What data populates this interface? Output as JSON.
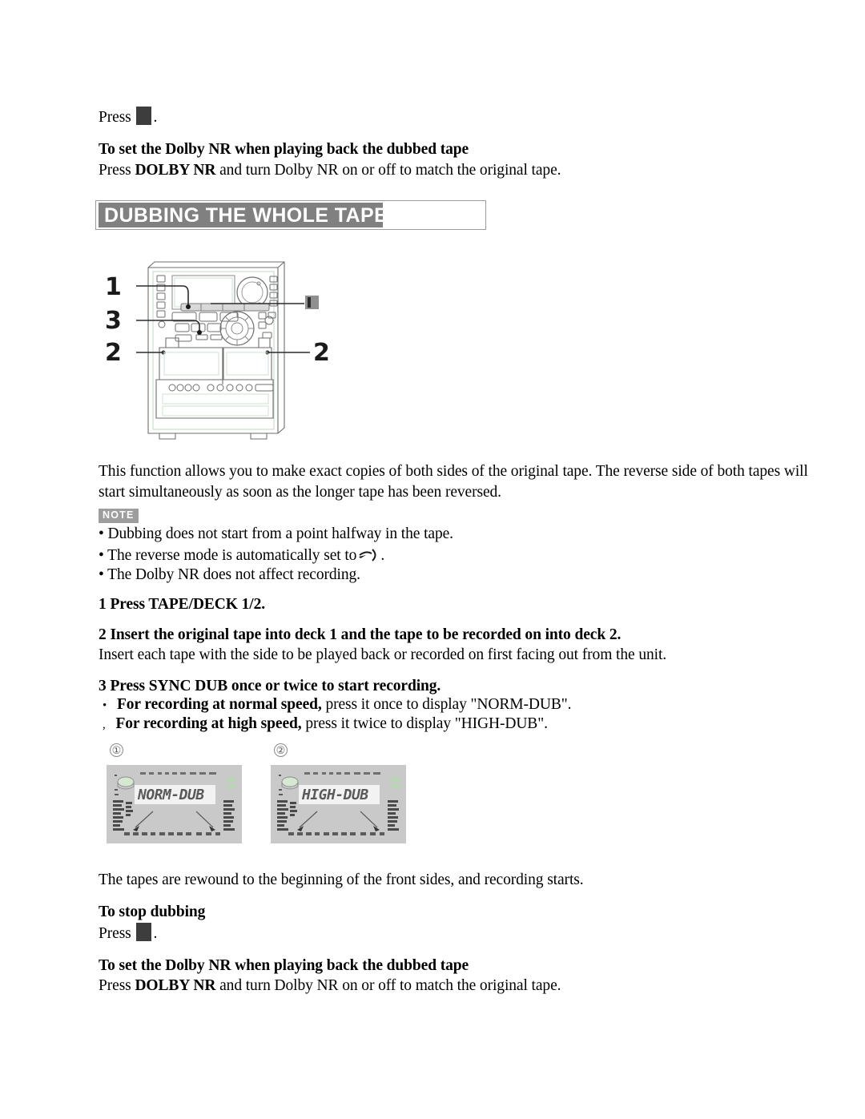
{
  "document": {
    "type": "audio-system-user-manual-page",
    "section_title": "DUBBING THE WHOLE TAPE"
  },
  "top_block": {
    "press_label": "Press",
    "press_icon": "stop-button-icon",
    "period": ".",
    "dolby_heading": "To set the Dolby NR when playing back the dubbed tape",
    "dolby_press": "Press",
    "dolby_button": "DOLBY NR",
    "dolby_rest": "and turn Dolby NR on or off to match the original tape."
  },
  "diagram": {
    "name": "stereo-system-front-panel-diagram",
    "callouts_left": [
      "1",
      "3",
      "2"
    ],
    "callouts_right": [
      "2"
    ],
    "right_icon": "stop-button-icon"
  },
  "intro": {
    "line1": "This function allows you to make exact copies of both sides of the original tape. The reverse side of both tapes will",
    "line2": "start simultaneously as soon as the longer tape has been reversed."
  },
  "note": {
    "badge": "NOTE",
    "bullets": [
      {
        "text": "Dubbing does not start from a point halfway in the tape.",
        "glyph": null
      },
      {
        "text": "The reverse mode is automatically set to",
        "glyph": "reverse-mode-loop-icon",
        "suffix": "."
      },
      {
        "text": "The Dolby NR does not affect recording.",
        "glyph": null
      }
    ]
  },
  "steps": [
    {
      "number": "1",
      "heading": "Press TAPE/DECK 1/2.",
      "body": null
    },
    {
      "number": "2",
      "heading": "Insert the original tape into deck 1 and the tape to be recorded on into deck 2.",
      "body": "Insert each tape with the side to be played back or recorded on first facing out from the unit."
    },
    {
      "number": "3",
      "heading": "Press SYNC DUB once or twice to start recording.",
      "body": null
    }
  ],
  "step3_bullets": [
    {
      "marker": "•",
      "bold": "For recording at normal speed,",
      "rest": "press it once to display \"NORM-DUB\"."
    },
    {
      "marker": ",",
      "bold": "For recording at high speed,",
      "rest": "press it twice to display \"HIGH-DUB\"."
    }
  ],
  "lcd_figures": [
    {
      "marker": "①",
      "display_text": "NORM-DUB",
      "name": "lcd-display-norm-dub"
    },
    {
      "marker": "②",
      "display_text": "HIGH-DUB",
      "name": "lcd-display-high-dub"
    }
  ],
  "after_figures": {
    "line": "The tapes are rewound to the beginning of the front sides, and recording starts."
  },
  "bottom_block": {
    "stop_heading": "To stop dubbing",
    "press_label": "Press",
    "press_icon": "stop-button-icon",
    "period": ".",
    "dolby_heading": "To set the Dolby NR when playing back the dubbed tape",
    "dolby_press": "Press",
    "dolby_button": "DOLBY NR",
    "dolby_rest": "and turn Dolby NR on or off to match the original tape."
  },
  "colors": {
    "title_bar": "#808080",
    "note_badge": "#9e9e9e",
    "stop_icon": "#3d3d3d",
    "lcd_panel": "#c9c9c9",
    "lcd_window": "#f2f2f2"
  }
}
